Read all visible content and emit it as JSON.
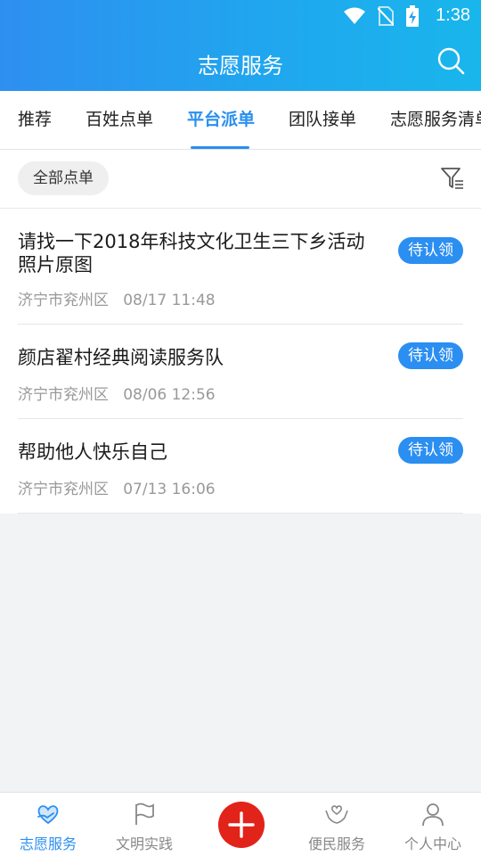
{
  "status_bar": {
    "time": "1:38"
  },
  "header": {
    "title": "志愿服务"
  },
  "tabs": [
    {
      "label": "推荐"
    },
    {
      "label": "百姓点单"
    },
    {
      "label": "平台派单"
    },
    {
      "label": "团队接单"
    },
    {
      "label": "志愿服务清单"
    }
  ],
  "active_tab": "平台派单",
  "filter": {
    "chip_label": "全部点单"
  },
  "items": [
    {
      "title": "请找一下2018年科技文化卫生三下乡活动照片原图",
      "location": "济宁市兖州区",
      "datetime": "08/17 11:48",
      "status": "待认领"
    },
    {
      "title": "颜店翟村经典阅读服务队",
      "location": "济宁市兖州区",
      "datetime": "08/06 12:56",
      "status": "待认领"
    },
    {
      "title": "帮助他人快乐自己",
      "location": "济宁市兖州区",
      "datetime": "07/13 16:06",
      "status": "待认领"
    }
  ],
  "bottom_nav": [
    {
      "label": "志愿服务",
      "icon": "heart-hands-icon"
    },
    {
      "label": "文明实践",
      "icon": "flag-icon"
    },
    {
      "label": "",
      "icon": "plus-icon"
    },
    {
      "label": "便民服务",
      "icon": "care-hands-icon"
    },
    {
      "label": "个人中心",
      "icon": "person-icon"
    }
  ],
  "colors": {
    "accent": "#2a8ff0",
    "fab": "#e2231a",
    "header_start": "#2e8ff0",
    "header_end": "#19b6ec"
  }
}
